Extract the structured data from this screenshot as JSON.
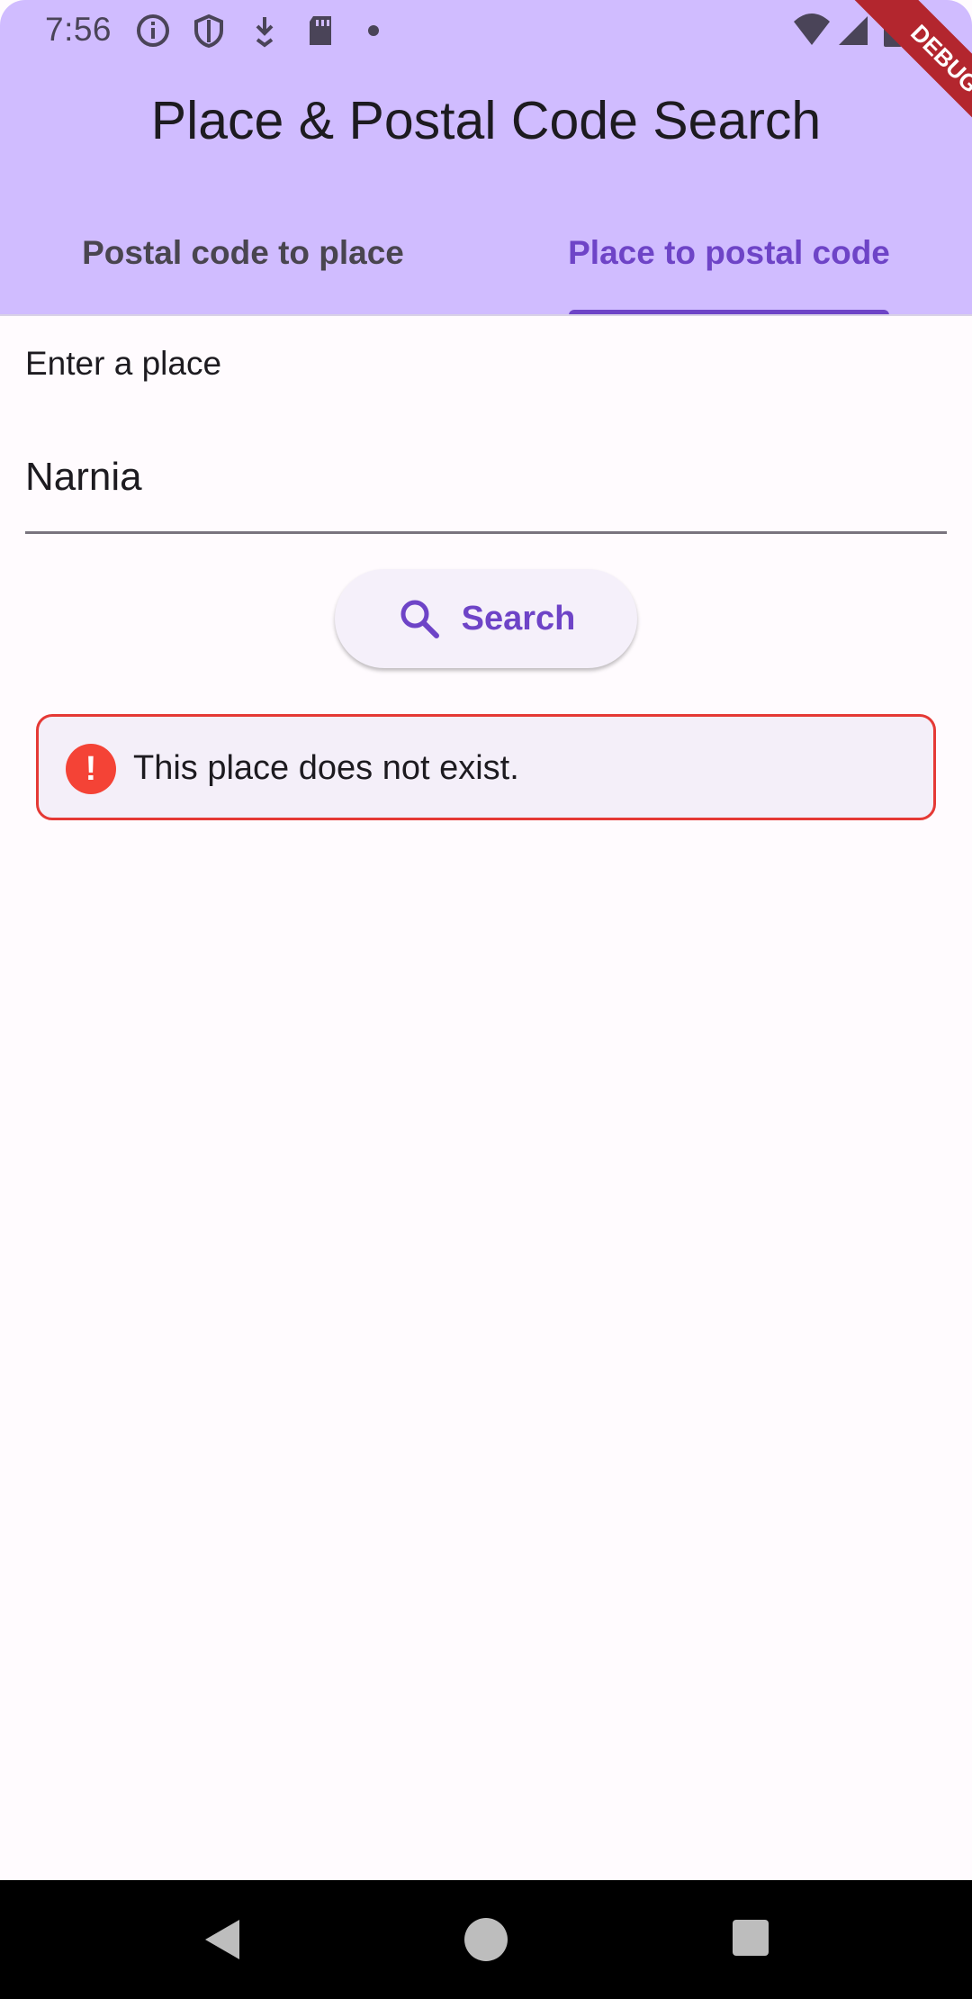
{
  "status_bar": {
    "time": "7:56",
    "left_icons": [
      "info-icon",
      "shield-icon",
      "download-icon",
      "sd-card-icon",
      "dot-icon"
    ],
    "right_icons": [
      "wifi-icon",
      "signal-icon",
      "battery-icon"
    ]
  },
  "debug_banner": "DEBUG",
  "app_bar": {
    "title": "Place & Postal Code Search",
    "background": "#d0bcff"
  },
  "tabs": [
    {
      "label": "Postal code to place",
      "selected": false
    },
    {
      "label": "Place to postal code",
      "selected": true
    }
  ],
  "form": {
    "label": "Enter a place",
    "value": "Narnia"
  },
  "search_button": {
    "label": "Search",
    "icon": "search-icon"
  },
  "error": {
    "message": "This place does not exist.",
    "icon": "error-icon",
    "icon_glyph": "!",
    "border_color": "#e53935"
  },
  "nav_bar": {
    "buttons": [
      "back-icon",
      "home-icon",
      "recents-icon"
    ]
  },
  "colors": {
    "accent": "#6e44c7",
    "error": "#f44336"
  }
}
